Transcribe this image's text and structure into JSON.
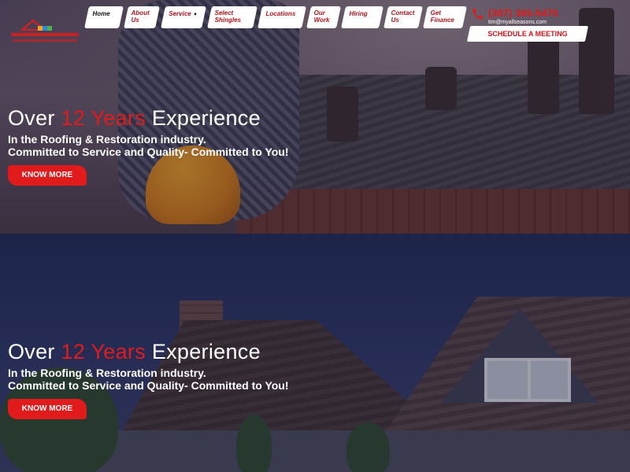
{
  "header": {
    "logo_alt": "All Seasons",
    "nav": [
      {
        "label": "Home",
        "has_caret": false
      },
      {
        "label": "About Us",
        "has_caret": false
      },
      {
        "label": "Service",
        "has_caret": true
      },
      {
        "label": "Select Shingles",
        "has_caret": false
      },
      {
        "label": "Locations",
        "has_caret": false
      },
      {
        "label": "Our Work",
        "has_caret": false
      },
      {
        "label": "Hiring",
        "has_caret": false
      },
      {
        "label": "Contact Us",
        "has_caret": false
      },
      {
        "label": "Get Finance",
        "has_caret": false
      }
    ],
    "phone": "(307) 365-5470",
    "email": "tim@myallseasons.com",
    "schedule_label": "SCHEDULE A MEETING",
    "phone_icon": "phone-icon",
    "accent_color": "#e11b1b"
  },
  "slides": [
    {
      "title_before": "Over ",
      "title_highlight": "12 Years",
      "title_after": " Experience",
      "line1": "In the Roofing & Restoration industry.",
      "line2": "Committed to Service and Quality- Committed to You!",
      "button_label": "KNOW MORE"
    },
    {
      "title_before": "Over ",
      "title_highlight": "12 Years",
      "title_after": " Experience",
      "line1": "In the Roofing & Restoration industry.",
      "line2": "Committed to Service and Quality- Committed to You!",
      "button_label": "KNOW MORE"
    }
  ]
}
